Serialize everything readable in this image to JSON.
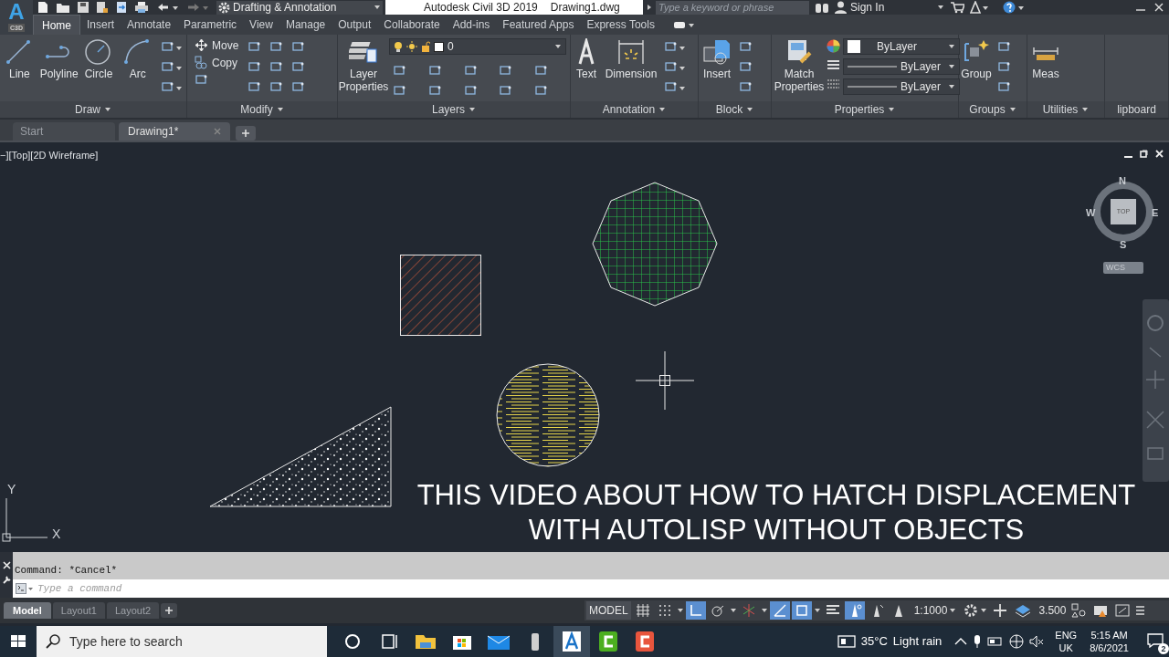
{
  "app_button": {
    "letter": "A",
    "product": "C3D"
  },
  "quick_access": {
    "workspace": "Drafting & Annotation"
  },
  "title_bar": {
    "product": "Autodesk Civil 3D 2019",
    "file": "Drawing1.dwg",
    "search": {
      "placeholder": "Type a keyword or phrase"
    },
    "sign_in": "Sign In"
  },
  "ribbon_tabs": [
    {
      "label": "Home",
      "selected": true
    },
    {
      "label": "Insert",
      "selected": false
    },
    {
      "label": "Annotate",
      "selected": false
    },
    {
      "label": "Parametric",
      "selected": false
    },
    {
      "label": "View",
      "selected": false
    },
    {
      "label": "Manage",
      "selected": false
    },
    {
      "label": "Output",
      "selected": false
    },
    {
      "label": "Collaborate",
      "selected": false
    },
    {
      "label": "Add-ins",
      "selected": false
    },
    {
      "label": "Featured Apps",
      "selected": false
    },
    {
      "label": "Express Tools",
      "selected": false
    }
  ],
  "ribbon_panels": [
    {
      "title": "Draw",
      "tools": [
        "Line",
        "Polyline",
        "Circle",
        "Arc"
      ]
    },
    {
      "title": "Modify",
      "small_tools": [
        "Move",
        "Copy"
      ]
    },
    {
      "title": "Layers",
      "tools": [
        "Layer Properties"
      ],
      "dropdowns": [
        "0"
      ]
    },
    {
      "title": "Annotation",
      "tools": [
        "Text",
        "Dimension"
      ]
    },
    {
      "title": "Block",
      "tools": [
        "Insert"
      ]
    },
    {
      "title": "Properties",
      "tools": [
        "Match Properties"
      ],
      "dropdowns": [
        "ByLayer",
        "ByLayer",
        "ByLayer"
      ]
    },
    {
      "title": "Groups",
      "tools": [
        "Group"
      ]
    },
    {
      "title": "Utilities",
      "tools": [
        "Meas"
      ]
    },
    {
      "title": "lipboard"
    }
  ],
  "document_tabs": [
    {
      "label": "Start",
      "selected": false
    },
    {
      "label": "Drawing1*",
      "selected": true
    }
  ],
  "viewport": {
    "label": "−][Top][2D Wireframe]",
    "viewcube": {
      "face": "TOP",
      "north": "N",
      "south": "S",
      "east": "E",
      "west": "W",
      "ucs": "WCS"
    },
    "ucs_axes": {
      "x": "X",
      "y": "Y"
    },
    "caption": [
      "THIS VIDEO ABOUT HOW TO HATCH DISPLACEMENT",
      "WITH AUTOLISP WITHOUT OBJECTS"
    ]
  },
  "command_line": {
    "history": "Command: *Cancel*",
    "placeholder": "Type a command"
  },
  "layout_tabs": [
    {
      "label": "Model",
      "selected": true
    },
    {
      "label": "Layout1",
      "selected": false
    },
    {
      "label": "Layout2",
      "selected": false
    }
  ],
  "status_bar": {
    "space": "MODEL",
    "scale": "1:1000",
    "value": "3.500",
    "toggles": [
      {
        "kind": "grid",
        "on": false
      },
      {
        "kind": "snap",
        "on": false
      },
      {
        "kind": "ortho",
        "on": true
      },
      {
        "kind": "polar",
        "on": false
      },
      {
        "kind": "track",
        "on": false
      },
      {
        "kind": "iso",
        "on": true
      },
      {
        "kind": "osnap",
        "on": true
      },
      {
        "kind": "lineweight",
        "on": false
      },
      {
        "kind": "annovis",
        "on": true
      },
      {
        "kind": "autoscale",
        "on": false
      },
      {
        "kind": "annoscale",
        "on": false
      }
    ]
  },
  "taskbar": {
    "search_placeholder": "Type here to search",
    "weather": "35°C",
    "weather_text": "Light rain",
    "language": "ENG",
    "region": "UK",
    "time": "5:15 AM",
    "date": "8/6/2021",
    "notifications": "2"
  }
}
